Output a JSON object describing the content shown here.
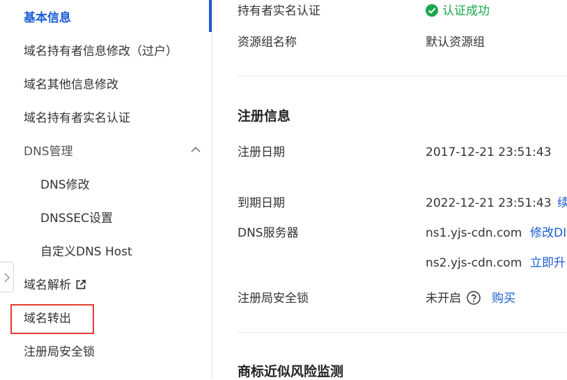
{
  "sidebar": {
    "items": [
      {
        "label": "基本信息"
      },
      {
        "label": "域名持有者信息修改（过户）"
      },
      {
        "label": "域名其他信息修改"
      },
      {
        "label": "域名持有者实名认证"
      },
      {
        "label": "DNS管理"
      },
      {
        "label": "DNS修改"
      },
      {
        "label": "DNSSEC设置"
      },
      {
        "label": "自定义DNS Host"
      },
      {
        "label": "域名解析"
      },
      {
        "label": "域名转出"
      },
      {
        "label": "注册局安全锁"
      }
    ]
  },
  "main": {
    "realname": {
      "label": "持有者实名认证",
      "value": "认证成功"
    },
    "resource_group": {
      "label": "资源组名称",
      "value": "默认资源组"
    },
    "registration": {
      "title": "注册信息",
      "reg_date": {
        "label": "注册日期",
        "value": "2017-12-21 23:51:43"
      },
      "exp_date": {
        "label": "到期日期",
        "value": "2022-12-21 23:51:43",
        "link": "续"
      },
      "dns": {
        "label": "DNS服务器",
        "ns1": "ns1.yjs-cdn.com",
        "ns1_link": "修改DI",
        "ns2": "ns2.yjs-cdn.com",
        "ns2_link": "立即升"
      },
      "lock": {
        "label": "注册局安全锁",
        "value": "未开启",
        "link": "购买"
      }
    },
    "trademark": {
      "title": "商标近似风险监测"
    }
  },
  "colors": {
    "accent": "#1a5bd4",
    "success": "#19a84b",
    "highlight": "#e53935"
  }
}
